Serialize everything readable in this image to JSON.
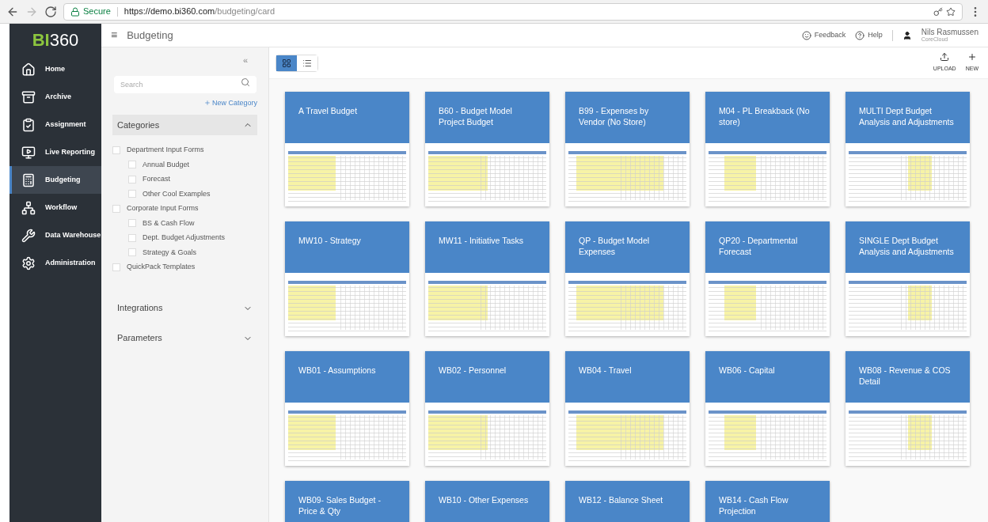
{
  "browser": {
    "secure_label": "Secure",
    "url_host": "https://demo.bi360.com",
    "url_path": "/budgeting/card"
  },
  "logo": {
    "brand": "BI",
    "number": "360"
  },
  "nav": [
    {
      "label": "Home",
      "selected": false
    },
    {
      "label": "Archive",
      "selected": false
    },
    {
      "label": "Assignment",
      "selected": false
    },
    {
      "label": "Live Reporting",
      "selected": false
    },
    {
      "label": "Budgeting",
      "selected": true
    },
    {
      "label": "Workflow",
      "selected": false
    },
    {
      "label": "Data Warehouse",
      "selected": false
    },
    {
      "label": "Administration",
      "selected": false
    }
  ],
  "header": {
    "menu_glyph": "≡",
    "title": "Budgeting",
    "feedback": "Feedback",
    "help": "Help",
    "user_name": "Nils Rasmussen",
    "user_org": "CoreCloud"
  },
  "filter_panel": {
    "collapse_glyph": "«",
    "search_placeholder": "Search",
    "new_category": "New Category",
    "sections": [
      {
        "title": "Categories",
        "expanded": true,
        "items": [
          {
            "label": "Department Input Forms",
            "checked": false,
            "children": [
              {
                "label": "Annual Budget",
                "checked": false
              },
              {
                "label": "Forecast",
                "checked": false
              },
              {
                "label": "Other Cool Examples",
                "checked": false
              }
            ]
          },
          {
            "label": "Corporate Input Forms",
            "checked": false,
            "children": [
              {
                "label": "BS & Cash Flow",
                "checked": false
              },
              {
                "label": "Dept. Budget Adjustments",
                "checked": false
              },
              {
                "label": "Strategy & Goals",
                "checked": false
              }
            ]
          },
          {
            "label": "QuickPack Templates",
            "checked": false
          }
        ]
      },
      {
        "title": "Integrations",
        "expanded": false
      },
      {
        "title": "Parameters",
        "expanded": false
      }
    ]
  },
  "toolbar": {
    "views": [
      {
        "kind": "grid",
        "selected": true
      },
      {
        "kind": "list",
        "selected": false
      }
    ],
    "upload": "UPLOAD",
    "new": "NEW"
  },
  "cards": [
    {
      "title": "A Travel Budget"
    },
    {
      "title": "B60 - Budget Model Project Budget"
    },
    {
      "title": "B99 - Expenses by Vendor (No Store)"
    },
    {
      "title": "M04 - PL Breakback (No store)"
    },
    {
      "title": "MULTI Dept Budget Analysis and Adjustments"
    },
    {
      "title": "MW10 - Strategy"
    },
    {
      "title": "MW11 - Initiative Tasks"
    },
    {
      "title": "QP - Budget Model Expenses"
    },
    {
      "title": "QP20 - Departmental Forecast"
    },
    {
      "title": "SINGLE Dept Budget Analysis and Adjustments"
    },
    {
      "title": "WB01 - Assumptions"
    },
    {
      "title": "WB02 - Personnel"
    },
    {
      "title": "WB04 - Travel"
    },
    {
      "title": "WB06 - Capital"
    },
    {
      "title": "WB08 - Revenue & COS Detail"
    },
    {
      "title": "WB09- Sales Budget - Price & Qty"
    },
    {
      "title": "WB10 - Other Expenses"
    },
    {
      "title": "WB12 - Balance Sheet"
    },
    {
      "title": "WB14 - Cash Flow Projection"
    }
  ]
}
